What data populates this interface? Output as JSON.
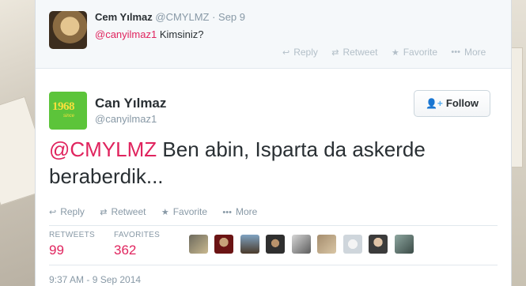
{
  "previous_tweet": {
    "name": "Cem Yılmaz",
    "handle": "@CMYLMZ",
    "separator": " · ",
    "time": "Sep 9",
    "mention": "@canyilmaz1",
    "text": " Kimsiniz?",
    "actions": {
      "reply": "Reply",
      "retweet": "Retweet",
      "favorite": "Favorite",
      "more": "More"
    }
  },
  "main_tweet": {
    "name": "Can Yılmaz",
    "handle": "@canyilmaz1",
    "avatar_text": "1968",
    "avatar_subtext": "since",
    "follow_label": "Follow",
    "mention": "@CMYLMZ",
    "text": " Ben abin, Isparta da askerde beraberdik...",
    "actions": {
      "reply": "Reply",
      "retweet": "Retweet",
      "favorite": "Favorite",
      "more": "More"
    },
    "stats": {
      "retweets_label": "RETWEETS",
      "retweets": "99",
      "favorites_label": "FAVORITES",
      "favorites": "362"
    },
    "timestamp": "9:37 AM - 9 Sep 2014"
  },
  "colors": {
    "accent": "#55acee",
    "mention": "#e0245e",
    "text": "#292f33",
    "muted": "#8899a6"
  }
}
